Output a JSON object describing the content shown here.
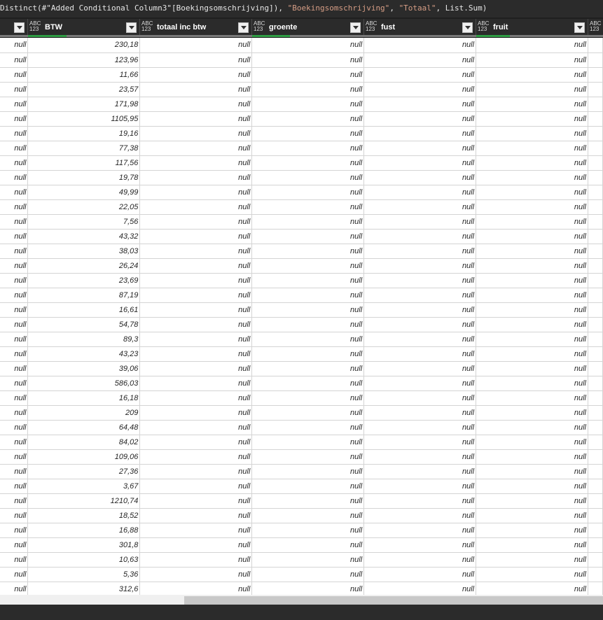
{
  "formula": {
    "part1": "Distinct(#\"Added Conditional Column3\"[Boekingsomschrijving]), ",
    "str1": "\"Boekingsomschrijving\"",
    "sep": ", ",
    "str2": "\"Totaal\"",
    "part2": ", List.Sum)"
  },
  "type_icon": {
    "top": "ABC",
    "bottom": "123"
  },
  "columns": [
    "",
    "BTW",
    "totaal inc btw",
    "groente",
    "fust",
    "fruit",
    ""
  ],
  "null_text": "null",
  "btw_values": [
    "230,18",
    "123,96",
    "11,66",
    "23,57",
    "171,98",
    "1105,95",
    "19,16",
    "77,38",
    "117,56",
    "19,78",
    "49,99",
    "22,05",
    "7,56",
    "43,32",
    "38,03",
    "26,24",
    "23,69",
    "87,19",
    "16,61",
    "54,78",
    "89,3",
    "43,23",
    "39,06",
    "586,03",
    "16,18",
    "209",
    "64,48",
    "84,02",
    "109,06",
    "27,36",
    "3,67",
    "1210,74",
    "18,52",
    "16,88",
    "301,8",
    "10,63",
    "5,36",
    "312,6"
  ],
  "colors": {
    "header_bg": "#2b2b2b",
    "quality_green": "#2f9e44",
    "string_literal": "#d69d85",
    "grid_line": "#d4d4d4"
  }
}
